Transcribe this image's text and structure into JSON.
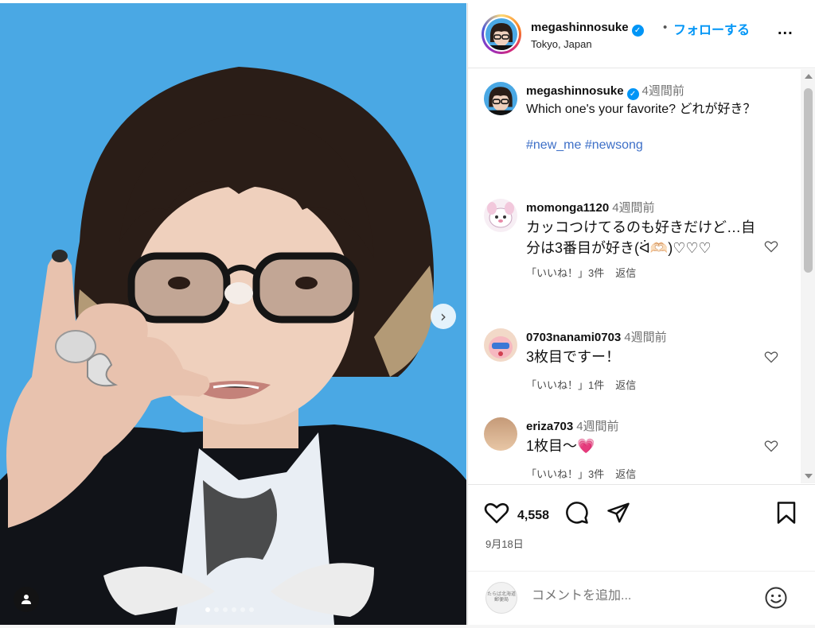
{
  "header": {
    "username": "megashinnosuke",
    "verified_mark": "✓",
    "separator": "•",
    "follow_label": "フォローする",
    "location": "Tokyo, Japan",
    "more_label": "..."
  },
  "media": {
    "next_arrow": "›",
    "carousel_total": 6,
    "carousel_active": 1,
    "bg_color": "#4aa8e4"
  },
  "caption": {
    "username": "megashinnosuke",
    "time": "4週間前",
    "text": "Which one's your favorite? どれが好き？",
    "hashtags": "#new_me #newsong"
  },
  "comments": [
    {
      "username": "momonga1120",
      "time": "4週間前",
      "text": "カッコつけてるのも好きだけど…自分は3番目が好き(ᐛ🫶🏻)♡♡♡",
      "likes": "「いいね！」3件",
      "reply": "返信"
    },
    {
      "username": "0703nanami0703",
      "time": "4週間前",
      "text": "3枚目ですー！",
      "likes": "「いいね！」1件",
      "reply": "返信"
    },
    {
      "username": "eriza703",
      "time": "4週間前",
      "text": "1枚目〜💗",
      "likes": "「いいね！」3件",
      "reply": "返信"
    }
  ],
  "actions": {
    "like_count": "4,558",
    "date": "9月18日",
    "comment_placeholder": "コメントを追加...",
    "my_avatar_text": "たらば北海道\n郵便局"
  },
  "colors": {
    "link": "#0095f6",
    "hashtag": "#3d6fc7",
    "heart": "#e8457a"
  }
}
